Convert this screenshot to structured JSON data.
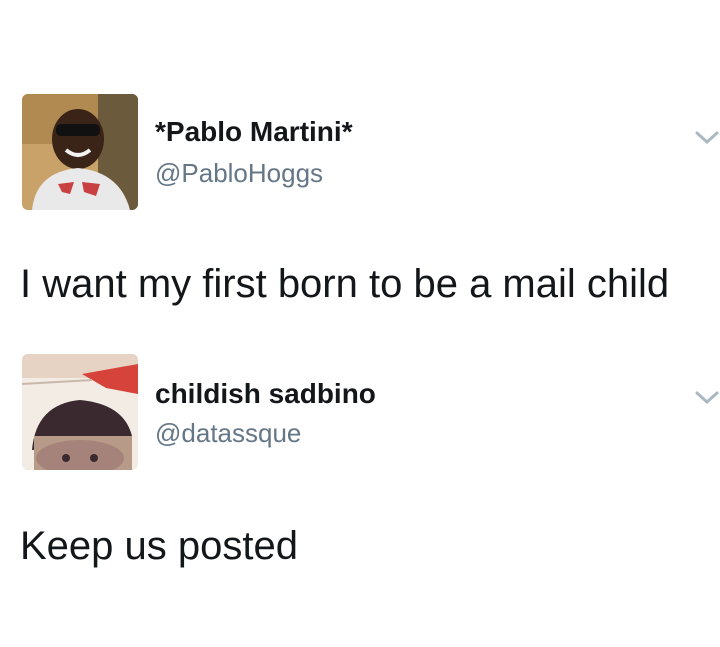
{
  "tweets": [
    {
      "display_name": "*Pablo Martini*",
      "handle": "@PabloHoggs",
      "text": "I want my first born to be a mail child",
      "avatar_icon": "user-avatar-photo",
      "menu_icon": "chevron-down-icon"
    },
    {
      "display_name": "childish sadbino",
      "handle": "@datassque",
      "text": "Keep us posted",
      "avatar_icon": "user-avatar-photo",
      "menu_icon": "chevron-down-icon"
    }
  ],
  "colors": {
    "text_primary": "#14171a",
    "text_secondary": "#657786",
    "chevron": "#aab8c2",
    "background": "#ffffff"
  }
}
